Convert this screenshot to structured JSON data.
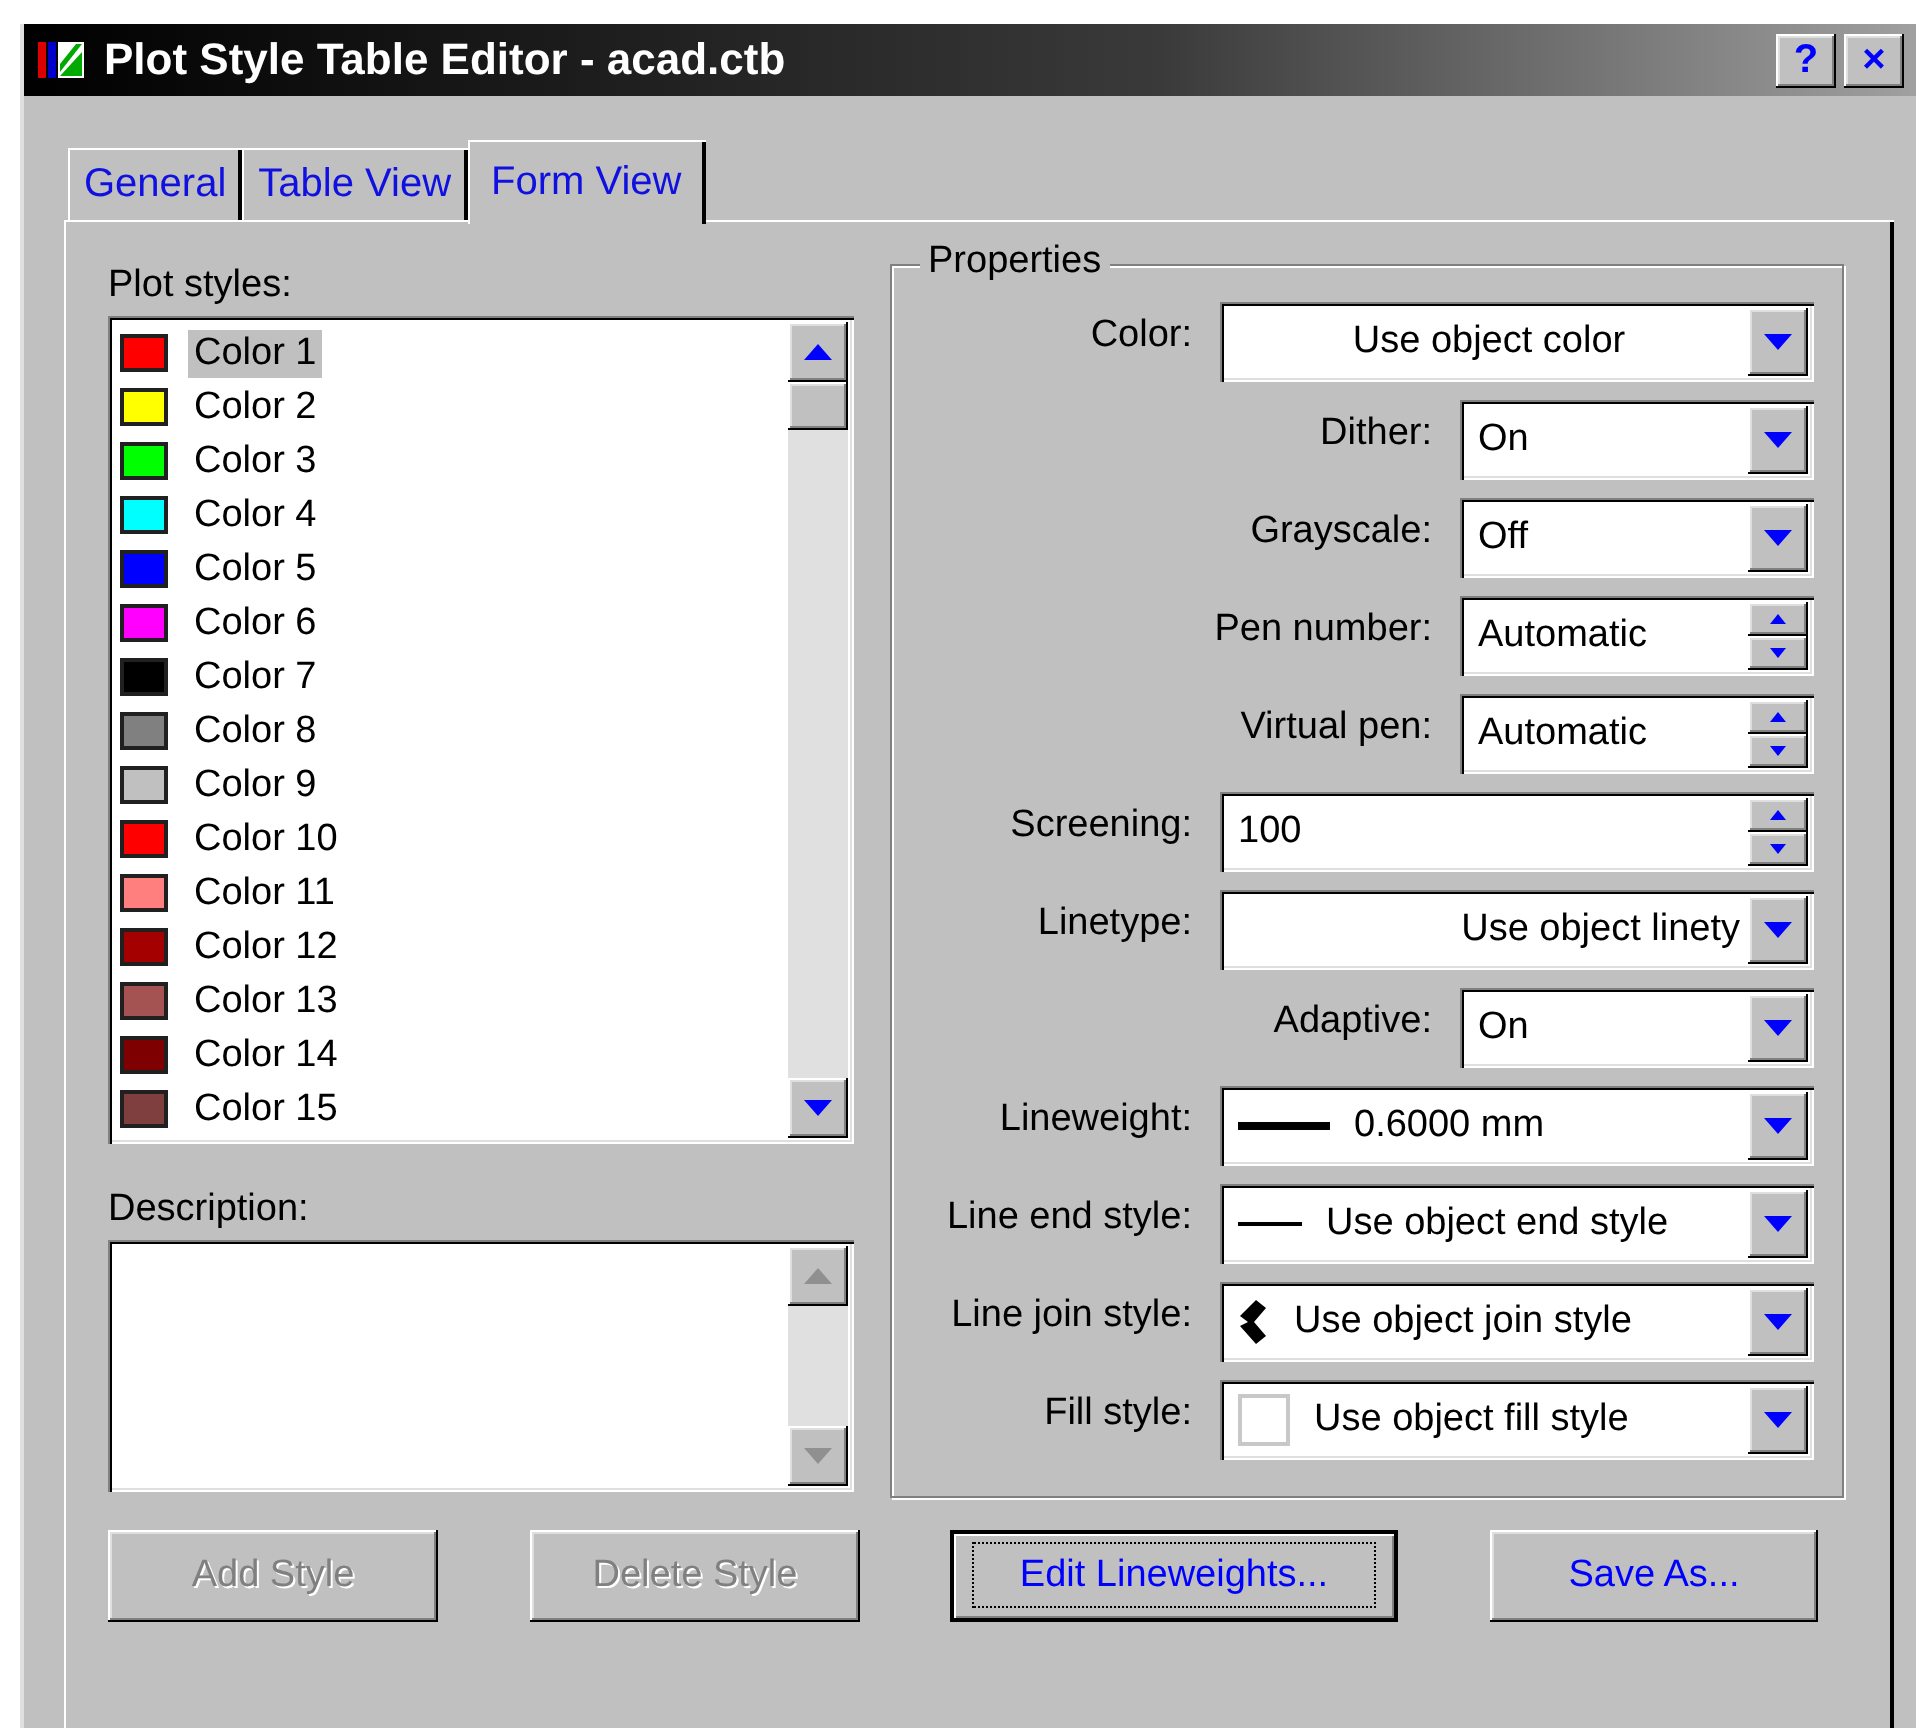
{
  "window": {
    "title": "Plot Style Table Editor - acad.ctb",
    "help_button": "?",
    "close_button": "×"
  },
  "tabs": [
    {
      "label": "General",
      "selected": false
    },
    {
      "label": "Table View",
      "selected": false
    },
    {
      "label": "Form View",
      "selected": true
    }
  ],
  "plot_styles": {
    "label": "Plot styles:",
    "items": [
      {
        "name": "Color 1",
        "color": "#ff0000",
        "selected": true
      },
      {
        "name": "Color 2",
        "color": "#ffff00",
        "selected": false
      },
      {
        "name": "Color 3",
        "color": "#00ff00",
        "selected": false
      },
      {
        "name": "Color 4",
        "color": "#00ffff",
        "selected": false
      },
      {
        "name": "Color 5",
        "color": "#0000ff",
        "selected": false
      },
      {
        "name": "Color 6",
        "color": "#ff00ff",
        "selected": false
      },
      {
        "name": "Color 7",
        "color": "#000000",
        "selected": false
      },
      {
        "name": "Color 8",
        "color": "#808080",
        "selected": false
      },
      {
        "name": "Color 9",
        "color": "#c0c0c0",
        "selected": false
      },
      {
        "name": "Color 10",
        "color": "#ff0000",
        "selected": false
      },
      {
        "name": "Color 11",
        "color": "#ff7f7f",
        "selected": false
      },
      {
        "name": "Color 12",
        "color": "#a50000",
        "selected": false
      },
      {
        "name": "Color 13",
        "color": "#a55252",
        "selected": false
      },
      {
        "name": "Color 14",
        "color": "#7f0000",
        "selected": false
      },
      {
        "name": "Color 15",
        "color": "#7f3f3f",
        "selected": false
      }
    ]
  },
  "description": {
    "label": "Description:"
  },
  "properties": {
    "title": "Properties",
    "rows": [
      {
        "kind": "combo",
        "label": "Color:",
        "value": "Use object color"
      },
      {
        "kind": "subcombo",
        "label": "Dither:",
        "value": "On"
      },
      {
        "kind": "subcombo",
        "label": "Grayscale:",
        "value": "Off"
      },
      {
        "kind": "subspinner",
        "label": "Pen number:",
        "value": "Automatic"
      },
      {
        "kind": "subspinner",
        "label": "Virtual pen:",
        "value": "Automatic"
      },
      {
        "kind": "spinner",
        "label": "Screening:",
        "value": "100"
      },
      {
        "kind": "combo",
        "label": "Linetype:",
        "value": "Use object linety"
      },
      {
        "kind": "subcombo",
        "label": "Adaptive:",
        "value": "On"
      },
      {
        "kind": "combo",
        "label": "Lineweight:",
        "value": "0.6000 mm"
      },
      {
        "kind": "combo",
        "label": "Line end style:",
        "value": "Use object end style"
      },
      {
        "kind": "combo",
        "label": "Line join style:",
        "value": "Use object join style"
      },
      {
        "kind": "combo",
        "label": "Fill style:",
        "value": "Use object fill style"
      }
    ]
  },
  "buttons": [
    {
      "label": "Add Style",
      "disabled": true,
      "focused": false
    },
    {
      "label": "Delete Style",
      "disabled": true,
      "focused": false
    },
    {
      "label": "Edit Lineweights...",
      "disabled": false,
      "focused": true
    },
    {
      "label": "Save As...",
      "disabled": false,
      "focused": false
    }
  ]
}
